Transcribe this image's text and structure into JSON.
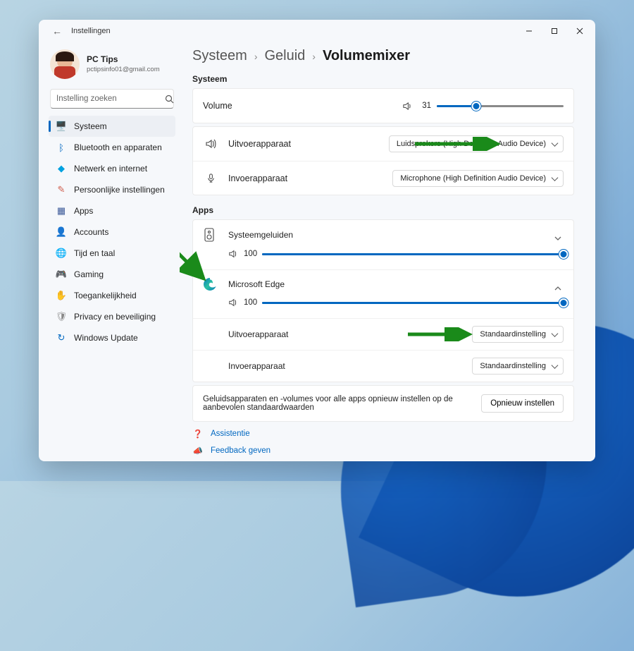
{
  "window": {
    "title": "Instellingen"
  },
  "profile": {
    "name": "PC Tips",
    "email": "pctipsinfo01@gmail.com"
  },
  "search": {
    "placeholder": "Instelling zoeken"
  },
  "nav": [
    {
      "icon": "🖥️",
      "label": "Systeem",
      "active": true,
      "color": "#0067c0"
    },
    {
      "icon": "ᛒ",
      "label": "Bluetooth en apparaten",
      "color": "#0067c0"
    },
    {
      "icon": "◆",
      "label": "Netwerk en internet",
      "color": "#00a1e0"
    },
    {
      "icon": "✎",
      "label": "Persoonlijke instellingen",
      "color": "#d06050"
    },
    {
      "icon": "▦",
      "label": "Apps",
      "color": "#3b5998"
    },
    {
      "icon": "👤",
      "label": "Accounts",
      "color": "#2aa775"
    },
    {
      "icon": "🌐",
      "label": "Tijd en taal",
      "color": "#4a6a8a"
    },
    {
      "icon": "🎮",
      "label": "Gaming",
      "color": "#3a8a3a"
    },
    {
      "icon": "✋",
      "label": "Toegankelijkheid",
      "color": "#3a6abf"
    },
    {
      "icon": "🛡",
      "label": "Privacy en beveiliging",
      "color": "#888"
    },
    {
      "icon": "↻",
      "label": "Windows Update",
      "color": "#0067c0"
    }
  ],
  "breadcrumb": {
    "a": "Systeem",
    "b": "Geluid",
    "c": "Volumemixer"
  },
  "sys": {
    "title": "Systeem",
    "volume_label": "Volume",
    "volume_val": "31",
    "volume_pct": 31,
    "output_label": "Uitvoerapparaat",
    "output_val": "Luidsprekers (High Definition Audio Device)",
    "input_label": "Invoerapparaat",
    "input_val": "Microphone (High Definition Audio Device)"
  },
  "apps": {
    "title": "Apps",
    "list": [
      {
        "name": "Systeemgeluiden",
        "vol": "100",
        "pct": 100,
        "icon": "speaker"
      },
      {
        "name": "Microsoft Edge",
        "vol": "100",
        "pct": 100,
        "icon": "edge"
      }
    ],
    "edge_out_label": "Uitvoerapparaat",
    "edge_out_val": "Standaardinstelling",
    "edge_in_label": "Invoerapparaat",
    "edge_in_val": "Standaardinstelling"
  },
  "reset": {
    "text": "Geluidsapparaten en -volumes voor alle apps opnieuw instellen op de aanbevolen standaardwaarden",
    "btn": "Opnieuw instellen"
  },
  "help": {
    "assist": "Assistentie",
    "feedback": "Feedback geven"
  }
}
